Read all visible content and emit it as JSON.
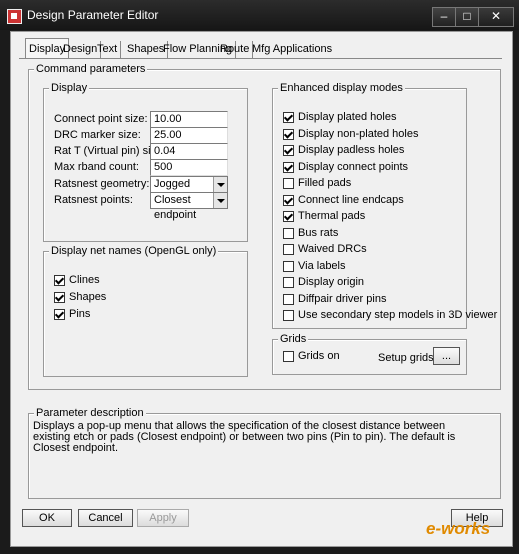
{
  "window": {
    "title": "Design Parameter Editor",
    "minimize": "–",
    "maximize": "□",
    "close": "✕"
  },
  "tabs": [
    "Display",
    "Design",
    "Text",
    "Shapes",
    "Flow Planning",
    "Route",
    "Mfg Applications"
  ],
  "command_params": {
    "label": "Command parameters"
  },
  "display": {
    "label": "Display",
    "fields": [
      {
        "label": "Connect point size:",
        "value": "10.00"
      },
      {
        "label": "DRC marker size:",
        "value": "25.00"
      },
      {
        "label": "Rat T (Virtual pin) size:",
        "value": "0.04"
      },
      {
        "label": "Max rband count:",
        "value": "500"
      }
    ],
    "ratsnest_geometry": {
      "label": "Ratsnest geometry:",
      "value": "Jogged"
    },
    "ratsnest_points": {
      "label": "Ratsnest points:",
      "value": "Closest endpoint"
    }
  },
  "net_names": {
    "label": "Display net names (OpenGL only)",
    "items": [
      {
        "label": "Clines",
        "checked": true
      },
      {
        "label": "Shapes",
        "checked": true
      },
      {
        "label": "Pins",
        "checked": true
      }
    ]
  },
  "enhanced": {
    "label": "Enhanced display modes",
    "items": [
      {
        "label": "Display plated holes",
        "checked": true
      },
      {
        "label": "Display non-plated holes",
        "checked": true
      },
      {
        "label": "Display padless holes",
        "checked": true
      },
      {
        "label": "Display connect points",
        "checked": true
      },
      {
        "label": "Filled pads",
        "checked": false
      },
      {
        "label": "Connect line endcaps",
        "checked": true
      },
      {
        "label": "Thermal pads",
        "checked": true
      },
      {
        "label": "Bus rats",
        "checked": false
      },
      {
        "label": "Waived DRCs",
        "checked": false
      },
      {
        "label": "Via labels",
        "checked": false
      },
      {
        "label": "Display origin",
        "checked": false
      },
      {
        "label": "Diffpair driver pins",
        "checked": false
      },
      {
        "label": "Use secondary step models in 3D viewer",
        "checked": false
      }
    ]
  },
  "grids": {
    "label": "Grids",
    "grids_on": {
      "label": "Grids on",
      "checked": false
    },
    "setup_label": "Setup grids",
    "setup_button": "..."
  },
  "description": {
    "label": "Parameter description",
    "text": "Displays a pop-up menu that allows the specification of the closest distance between existing etch or pads (Closest endpoint) or between two pins (Pin to pin). The default is Closest endpoint."
  },
  "buttons": {
    "ok": "OK",
    "cancel": "Cancel",
    "apply": "Apply",
    "help": "Help"
  },
  "watermark": "e-works"
}
